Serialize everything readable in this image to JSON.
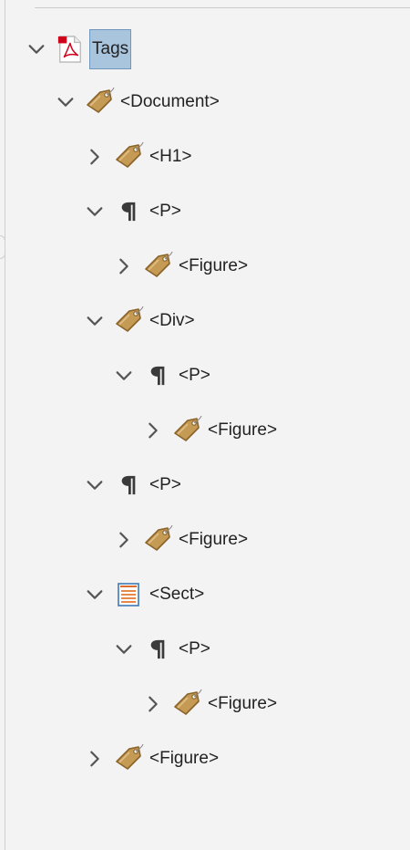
{
  "tree": {
    "root": {
      "label": "Tags",
      "icon": "pdf-icon"
    },
    "items": [
      {
        "label": "<Document>",
        "icon": "tag-icon"
      },
      {
        "label": "<H1>",
        "icon": "tag-icon"
      },
      {
        "label": "<P>",
        "icon": "pilcrow-icon"
      },
      {
        "label": "<Figure>",
        "icon": "tag-icon"
      },
      {
        "label": "<Div>",
        "icon": "tag-icon"
      },
      {
        "label": "<P>",
        "icon": "pilcrow-icon"
      },
      {
        "label": "<Figure>",
        "icon": "tag-icon"
      },
      {
        "label": "<P>",
        "icon": "pilcrow-icon"
      },
      {
        "label": "<Figure>",
        "icon": "tag-icon"
      },
      {
        "label": "<Sect>",
        "icon": "section-icon"
      },
      {
        "label": "<P>",
        "icon": "pilcrow-icon"
      },
      {
        "label": "<Figure>",
        "icon": "tag-icon"
      },
      {
        "label": "<Figure>",
        "icon": "tag-icon"
      }
    ]
  },
  "colors": {
    "selection": "#a9c4dd",
    "tag": "#c59a55",
    "pdf": "#d0021b",
    "chevron": "#555555"
  }
}
